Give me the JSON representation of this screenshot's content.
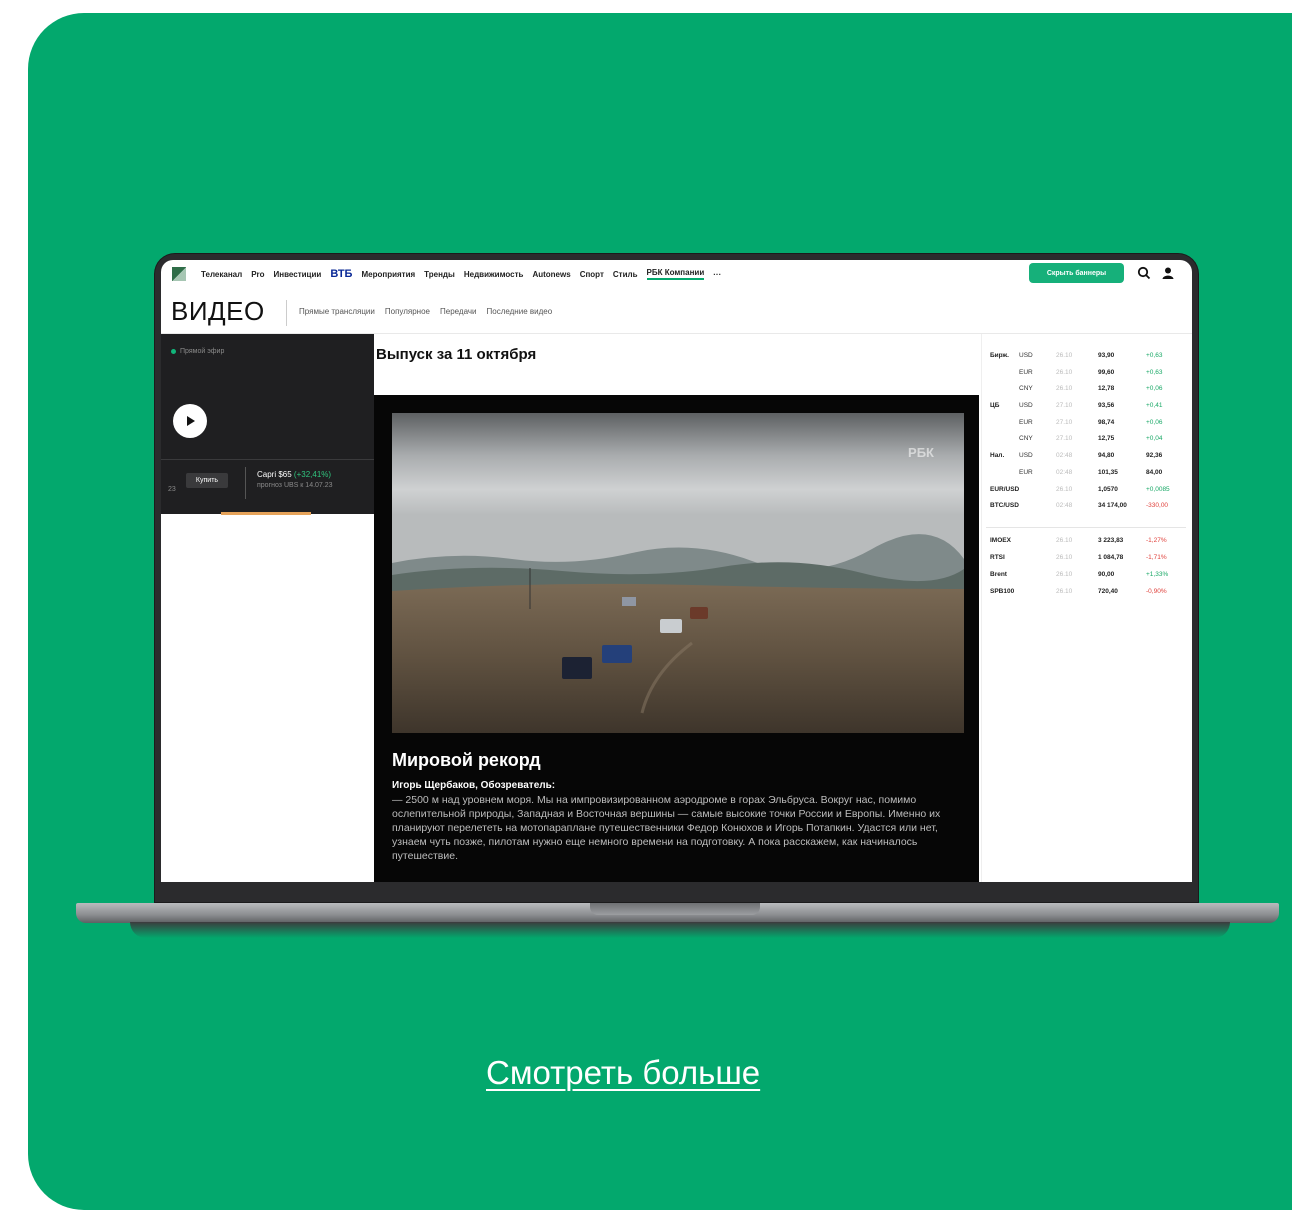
{
  "nav": {
    "items": [
      "Телеканал",
      "Pro",
      "Инвестиции",
      "ВТБ",
      "Мероприятия",
      "Тренды",
      "Недвижимость",
      "Autonews",
      "Спорт",
      "Стиль",
      "РБК Компании",
      "···"
    ],
    "hide_banners": "Скрыть баннеры"
  },
  "section": {
    "title": "ВИДЕО",
    "links": [
      "Прямые трансляции",
      "Популярное",
      "Передачи",
      "Последние видео"
    ]
  },
  "left": {
    "live": "Прямой эфир",
    "ad_num": "23",
    "buy": "Купить",
    "ad_title": "Capri $65",
    "ad_change": "(+32,41%)",
    "ad_sub": "прогноз UBS к 14.07.23"
  },
  "main": {
    "heading": "Выпуск за 11 октября",
    "watermark": "РБК",
    "story_title": "Мировой рекорд",
    "story_author": "Игорь Щербаков, Обозреватель:",
    "story_text": "— 2500 м над уровнем моря. Мы на импровизированном аэродроме в горах Эльбруса. Вокруг нас, помимо ослепительной природы, Западная и Восточная вершины — самые высокие точки России и Европы. Именно их планируют перелететь на мотопараплане путешественники Федор Конюхов и Игорь Потапкин. Удастся или нет, узнаем чуть позже, пилотам нужно еще немного времени на подготовку. А пока расскажем, как начиналось путешествие."
  },
  "rates": [
    {
      "group": "Бирж.",
      "cur": "USD",
      "date": "26.10",
      "val": "93,90",
      "chg": "+0,63",
      "dir": "pos"
    },
    {
      "group": "",
      "cur": "EUR",
      "date": "26.10",
      "val": "99,60",
      "chg": "+0,63",
      "dir": "pos"
    },
    {
      "group": "",
      "cur": "CNY",
      "date": "26.10",
      "val": "12,78",
      "chg": "+0,06",
      "dir": "pos"
    },
    {
      "group": "ЦБ",
      "cur": "USD",
      "date": "27.10",
      "val": "93,56",
      "chg": "+0,41",
      "dir": "pos"
    },
    {
      "group": "",
      "cur": "EUR",
      "date": "27.10",
      "val": "98,74",
      "chg": "+0,06",
      "dir": "pos"
    },
    {
      "group": "",
      "cur": "CNY",
      "date": "27.10",
      "val": "12,75",
      "chg": "+0,04",
      "dir": "pos"
    },
    {
      "group": "Нал.",
      "cur": "USD",
      "date": "02:48",
      "val": "94,80",
      "chg": "92,36",
      "dir": ""
    },
    {
      "group": "",
      "cur": "EUR",
      "date": "02:48",
      "val": "101,35",
      "chg": "84,00",
      "dir": ""
    },
    {
      "group": "EUR/USD",
      "cur": "",
      "date": "26.10",
      "val": "1,0570",
      "chg": "+0,0085",
      "dir": "pos"
    },
    {
      "group": "BTC/USD",
      "cur": "",
      "date": "02:48",
      "val": "34 174,00",
      "chg": "-330,00",
      "dir": "neg"
    }
  ],
  "indices": [
    {
      "name": "IMOEX",
      "date": "26.10",
      "val": "3 223,83",
      "chg": "-1,27%",
      "dir": "neg"
    },
    {
      "name": "RTSI",
      "date": "26.10",
      "val": "1 084,78",
      "chg": "-1,71%",
      "dir": "neg"
    },
    {
      "name": "Brent",
      "date": "26.10",
      "val": "90,00",
      "chg": "+1,33%",
      "dir": "pos"
    },
    {
      "name": "SPB100",
      "date": "26.10",
      "val": "720,40",
      "chg": "-0,90%",
      "dir": "neg"
    }
  ],
  "cta": "Смотреть больше",
  "colors": {
    "background": "#03a86d",
    "accent_green": "#16b07a",
    "vtb_blue": "#0a2896"
  }
}
